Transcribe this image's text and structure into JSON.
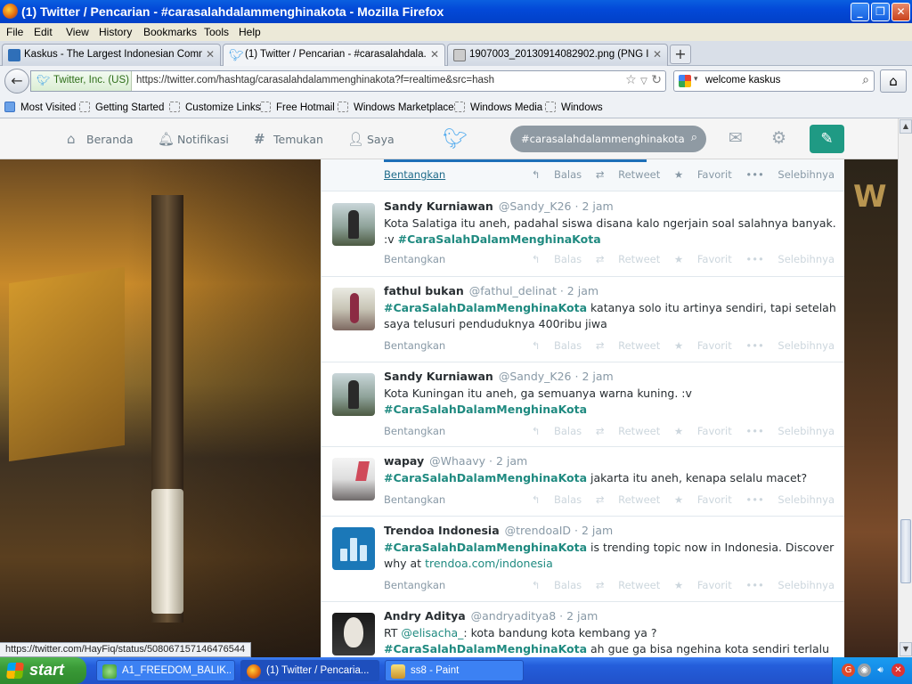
{
  "window": {
    "title": "(1) Twitter / Pencarian - #carasalahdalammenghinakota - Mozilla Firefox",
    "controls": [
      "_",
      "❐",
      "✕"
    ]
  },
  "menu": [
    "File",
    "Edit",
    "View",
    "History",
    "Bookmarks",
    "Tools",
    "Help"
  ],
  "tabs": [
    {
      "label": "Kaskus - The Largest Indonesian Commu...",
      "icon": "kaskus-icon",
      "close": "✕"
    },
    {
      "label": "(1) Twitter / Pencarian - #carasalahdala...",
      "icon": "twitter-bird-icon",
      "close": "✕"
    },
    {
      "label": "1907003_20130914082902.png (PNG Im...",
      "icon": "image-icon",
      "close": "✕"
    }
  ],
  "new_tab": "+",
  "nav": {
    "identity": "Twitter, Inc. (US)",
    "url": "https://twitter.com/hashtag/carasalahdalammenghinakota?f=realtime&src=hash",
    "search_value": "welcome kaskus"
  },
  "bookmarks": [
    "Most Visited",
    "Getting Started",
    "Customize Links",
    "Free Hotmail",
    "Windows Marketplace",
    "Windows Media",
    "Windows"
  ],
  "twitter_nav": {
    "items": [
      "Beranda",
      "Notifikasi",
      "Temukan",
      "Saya"
    ],
    "search_query": "#carasalahdalammenghinakota"
  },
  "partial_tweet": {
    "expand": "Bentangkan",
    "actions": [
      "Balas",
      "Retweet",
      "Favorit",
      "Selebihnya"
    ]
  },
  "tweets": [
    {
      "name": "Sandy Kurniawan",
      "handle": "@Sandy_K26",
      "time": "· 2 jam",
      "text_before": "Kota Salatiga itu aneh, padahal siswa disana kalo ngerjain soal salahnya banyak. :v ",
      "hashtag": "#CaraSalahDalamMenghinaKota",
      "text_after": "",
      "expand": "Bentangkan"
    },
    {
      "name": "fathul bukan",
      "handle": "@fathul_delinat",
      "time": "· 2 jam",
      "text_before": "",
      "hashtag": "#CaraSalahDalamMenghinaKota",
      "text_after": " katanya solo itu artinya sendiri, tapi setelah saya telusuri penduduknya 400ribu jiwa",
      "expand": "Bentangkan"
    },
    {
      "name": "Sandy Kurniawan",
      "handle": "@Sandy_K26",
      "time": "· 2 jam",
      "text_before": "Kota Kuningan itu aneh, ga semuanya warna kuning. :v ",
      "hashtag": "#CaraSalahDalamMenghinaKota",
      "text_after": "",
      "expand": "Bentangkan"
    },
    {
      "name": "wapay",
      "handle": "@Whaavy",
      "time": "· 2 jam",
      "text_before": "",
      "hashtag": "#CaraSalahDalamMenghinaKota",
      "text_after": " jakarta itu aneh, kenapa selalu macet?",
      "expand": "Bentangkan"
    },
    {
      "name": "Trendoa Indonesia",
      "handle": "@trendoaID",
      "time": "· 2 jam",
      "text_before": "",
      "hashtag": "#CaraSalahDalamMenghinaKota",
      "text_after": " is trending topic now in Indonesia. Discover why at ",
      "link": "trendoa.com/indonesia",
      "expand": "Bentangkan"
    },
    {
      "name": "Andry Aditya",
      "handle": "@andryaditya8",
      "time": "· 2 jam",
      "rt_prefix": "RT ",
      "mention": "@elisacha_",
      "rt_text": ": kota bandung kota kembang ya ?",
      "hashtag": "#CaraSalahDalamMenghinaKota",
      "text_after": " ah gue ga bisa ngehina kota sendiri terlalu"
    }
  ],
  "tweet_actions": [
    "Balas",
    "Retweet",
    "Favorit",
    "Selebihnya"
  ],
  "status_url": "https://twitter.com/HayFiq/status/508067157146476544",
  "taskbar": {
    "start": "start",
    "tasks": [
      "A1_FREEDOM_BALIK...",
      "(1) Twitter / Pencaria...",
      "ss8 - Paint"
    ]
  },
  "colors": {
    "hashtag": "#1f8a80",
    "twitter_blue": "#55acee",
    "compose": "#1f9a84",
    "xp_taskbar": "#245edb"
  }
}
